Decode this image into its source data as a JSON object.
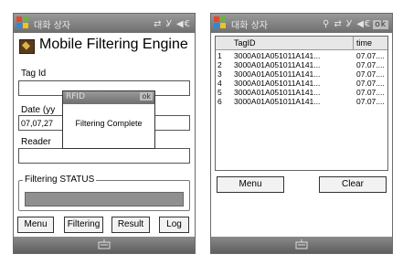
{
  "status_bar": {
    "app_name": "대화 상자",
    "left_indicators": "⇄ Ỿ ◀€",
    "right_indicators": "⚲ ⇄ Ỿ ◀€",
    "ok_label": "ok"
  },
  "left_screen": {
    "app_title": "Mobile Filtering Engine",
    "tag_id_label": "Tag Id",
    "tag_id_value": "",
    "date_label": "Date (yy",
    "date_value": "07,07,27",
    "reader_label": "Reader",
    "reader_value": "",
    "status_group_label": "Filtering STATUS",
    "status_progress": 1.0,
    "buttons": {
      "menu": "Menu",
      "filtering": "Filtering",
      "result": "Result",
      "log": "Log"
    },
    "dialog": {
      "title": "RFID",
      "ok": "ok",
      "message": "Filtering Complete"
    }
  },
  "right_screen": {
    "columns": [
      "TagID",
      "time"
    ],
    "rows": [
      {
        "num": "1",
        "tag": "3000A01A051011A141...",
        "time": "07.07...."
      },
      {
        "num": "2",
        "tag": "3000A01A051011A141...",
        "time": "07.07...."
      },
      {
        "num": "3",
        "tag": "3000A01A051011A141...",
        "time": "07.07...."
      },
      {
        "num": "4",
        "tag": "3000A01A051011A141...",
        "time": "07.07...."
      },
      {
        "num": "5",
        "tag": "3000A01A051011A141...",
        "time": "07.07...."
      },
      {
        "num": "6",
        "tag": "3000A01A051011A141...",
        "time": "07.07...."
      }
    ],
    "buttons": {
      "menu": "Menu",
      "clear": "Clear"
    }
  },
  "colors": {
    "bar_dark": "#6e6e6e",
    "bar_light": "#9a9a9a",
    "progress_fill": "#8f8f8f"
  }
}
